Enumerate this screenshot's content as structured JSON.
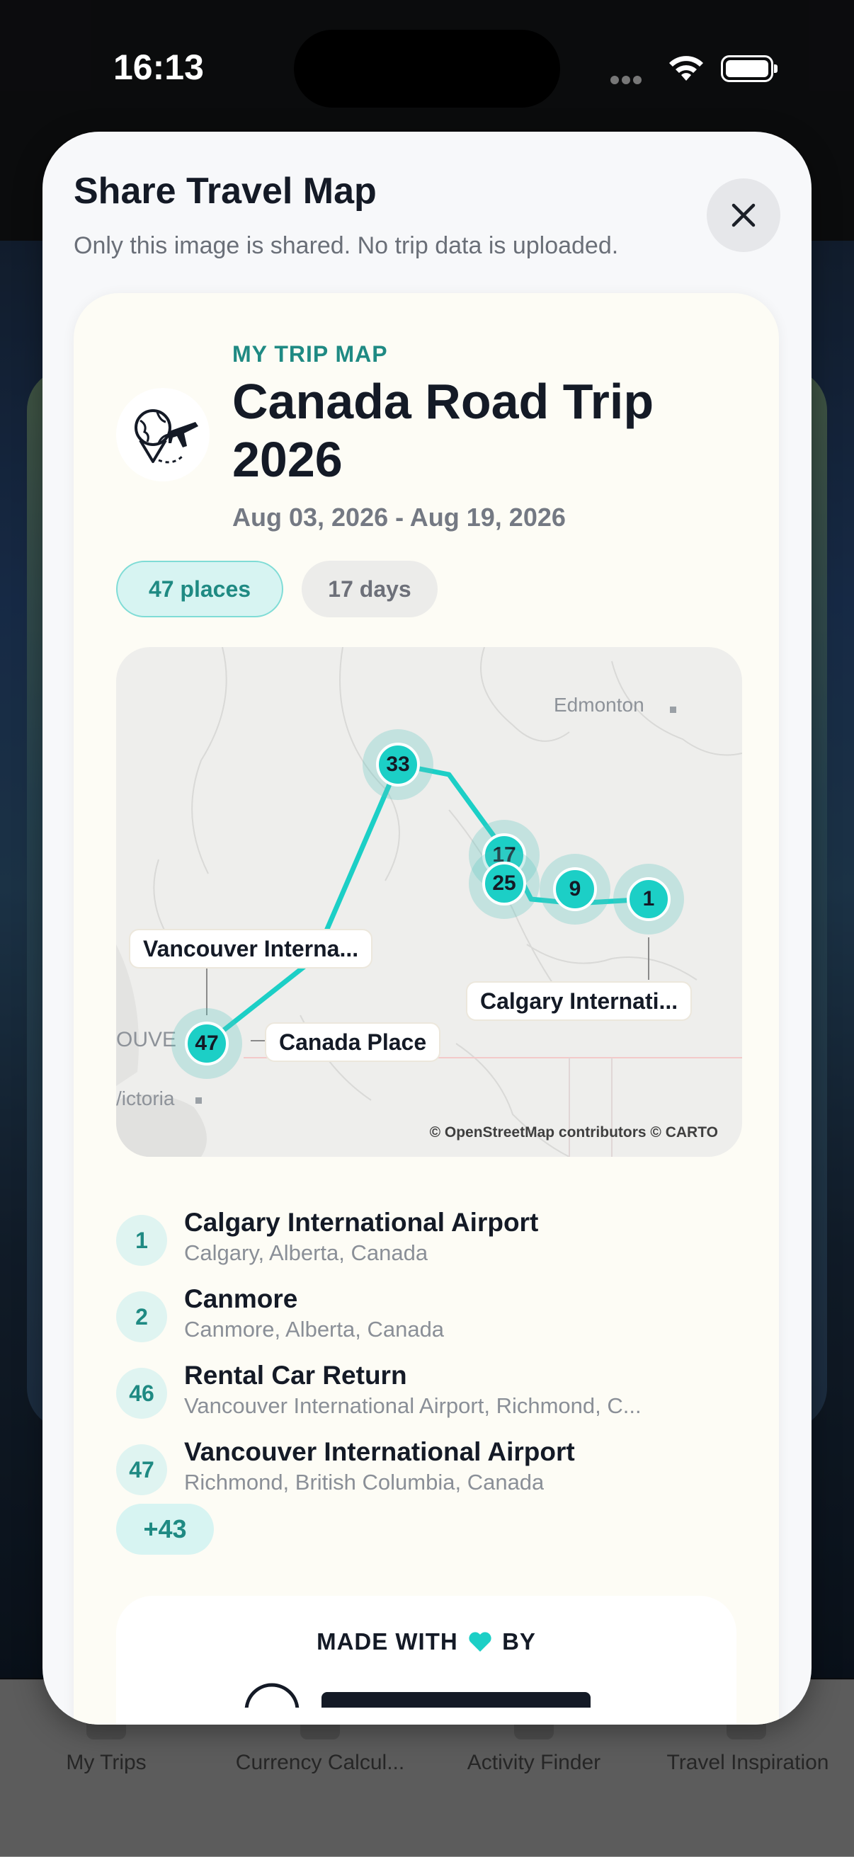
{
  "status_bar": {
    "time": "16:13"
  },
  "tabbar": {
    "tabs": [
      {
        "label": "My Trips"
      },
      {
        "label": "Currency Calcul..."
      },
      {
        "label": "Activity Finder"
      },
      {
        "label": "Travel Inspiration"
      }
    ]
  },
  "sheet": {
    "title": "Share Travel Map",
    "subtitle": "Only this image is shared. No trip data is uploaded.",
    "card": {
      "eyebrow": "MY TRIP MAP",
      "trip_title": "Canada Road Trip 2026",
      "dates": "Aug 03, 2026 - Aug 19, 2026",
      "chips": {
        "places": "47 places",
        "days": "17 days"
      },
      "map": {
        "place_names": {
          "edmonton": "Edmonton",
          "vancouver": "OUVE",
          "victoria": "/ictoria"
        },
        "labels": {
          "vancouver_airport": "Vancouver Interna...",
          "canada_place": "Canada Place",
          "calgary_airport": "Calgary Internati..."
        },
        "clusters": [
          "33",
          "17",
          "25",
          "9",
          "1",
          "47"
        ],
        "attribution": "© OpenStreetMap contributors © CARTO"
      },
      "stops": [
        {
          "num": "1",
          "name": "Calgary International Airport",
          "address": "Calgary, Alberta, Canada"
        },
        {
          "num": "2",
          "name": "Canmore",
          "address": "Canmore, Alberta, Canada"
        },
        {
          "num": "46",
          "name": "Rental Car Return",
          "address": "Vancouver International Airport, Richmond, C..."
        },
        {
          "num": "47",
          "name": "Vancouver International Airport",
          "address": "Richmond, British Columbia, Canada"
        }
      ],
      "more": "+43",
      "made_with": {
        "prefix": "MADE WITH",
        "suffix": "BY"
      }
    }
  },
  "colors": {
    "accent": "#1ccfc6",
    "accent_dark": "#1f8a83",
    "heart": "#1ccfc6"
  }
}
